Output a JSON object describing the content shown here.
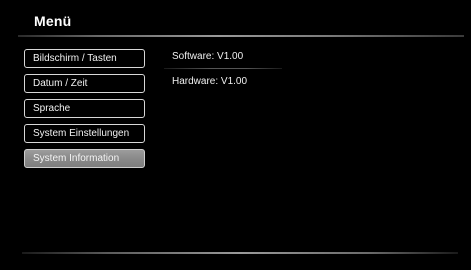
{
  "header": {
    "title": "Menü"
  },
  "menu": {
    "items": [
      {
        "label": "Bildschirm / Tasten",
        "selected": false
      },
      {
        "label": "Datum / Zeit",
        "selected": false
      },
      {
        "label": "Sprache",
        "selected": false
      },
      {
        "label": "System Einstellungen",
        "selected": false
      },
      {
        "label": "System Information",
        "selected": true
      }
    ]
  },
  "info": {
    "software": "Software: V1.00",
    "hardware": "Hardware: V1.00"
  },
  "colors": {
    "background": "#000000",
    "text": "#ffffff",
    "item_border": "#d8d8d8",
    "selected_fill": "#8a8a8a"
  }
}
